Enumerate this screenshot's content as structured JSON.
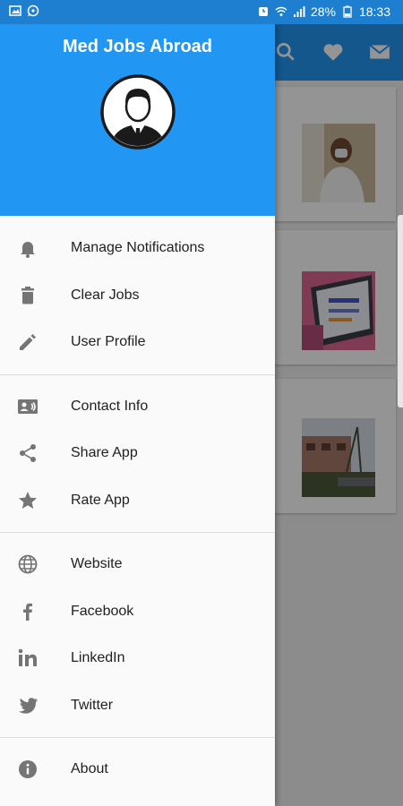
{
  "status_bar": {
    "battery": "28%",
    "time": "18:33"
  },
  "drawer": {
    "title": "Med Jobs Abroad",
    "groups": [
      [
        {
          "label": "Manage Notifications",
          "icon": "bell-icon"
        },
        {
          "label": "Clear Jobs",
          "icon": "trash-icon"
        },
        {
          "label": "User Profile",
          "icon": "pencil-icon"
        }
      ],
      [
        {
          "label": "Contact Info",
          "icon": "contact-card-icon"
        },
        {
          "label": "Share App",
          "icon": "share-icon"
        },
        {
          "label": "Rate App",
          "icon": "star-icon"
        }
      ],
      [
        {
          "label": "Website",
          "icon": "globe-icon"
        },
        {
          "label": "Facebook",
          "icon": "facebook-icon"
        },
        {
          "label": "LinkedIn",
          "icon": "linkedin-icon"
        },
        {
          "label": "Twitter",
          "icon": "twitter-icon"
        }
      ],
      [
        {
          "label": "About",
          "icon": "info-icon"
        }
      ]
    ]
  },
  "colors": {
    "primary": "#2196f3",
    "status_bar": "#1e7fd1",
    "icon_gray": "#757575"
  }
}
